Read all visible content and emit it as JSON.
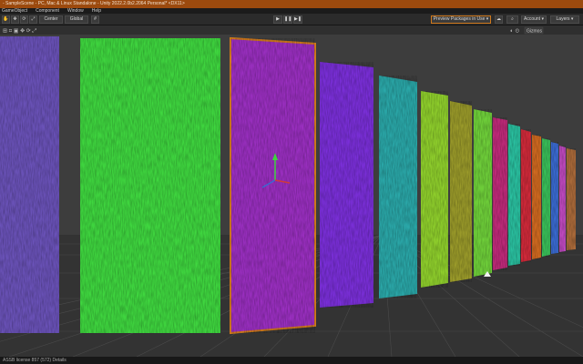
{
  "window": {
    "title": "- SampleScene - PC, Mac & Linux Standalone - Unity 2022.2.0b2.2064 Personal* <DX11>"
  },
  "menu": [
    "GameObject",
    "Component",
    "Window",
    "Help"
  ],
  "toolbar": {
    "center_label": "Center",
    "global_label": "Global",
    "preview_packages_label": "Preview Packages in Use",
    "account_label": "Account",
    "layers_label": "Layers",
    "gizmos_label": "Gizmos"
  },
  "status": {
    "text": "ASSB license 857 (572) Details"
  },
  "colors": {
    "accent": "#d0791c",
    "title_bar": "#9c4a0e",
    "panel": "#2b2b2b"
  },
  "scene": {
    "panels": [
      {
        "name": "panel-purple-left",
        "color": "#6a52b8"
      },
      {
        "name": "panel-green",
        "color": "#3fd63f"
      },
      {
        "name": "panel-selected-purple",
        "color": "#9a2fc0"
      },
      {
        "name": "panel-violet",
        "color": "#7a2fd8"
      },
      {
        "name": "panel-cyan",
        "color": "#2aa7a8"
      },
      {
        "name": "panel-yellow-green",
        "color": "#8fcf2c"
      },
      {
        "name": "panel-olive",
        "color": "#9a9a2a"
      },
      {
        "name": "panel-lime",
        "color": "#6fd03a"
      },
      {
        "name": "panel-magenta",
        "color": "#c02a7a"
      },
      {
        "name": "panel-teal",
        "color": "#2ac0a0"
      },
      {
        "name": "panel-red",
        "color": "#d02a3a"
      },
      {
        "name": "panel-orange",
        "color": "#d06a20"
      },
      {
        "name": "panel-green-2",
        "color": "#3ac05a"
      },
      {
        "name": "panel-blue",
        "color": "#3a6ad0"
      },
      {
        "name": "panel-pink",
        "color": "#c04ac0"
      },
      {
        "name": "panel-far",
        "color": "#aa6a3a"
      }
    ]
  }
}
